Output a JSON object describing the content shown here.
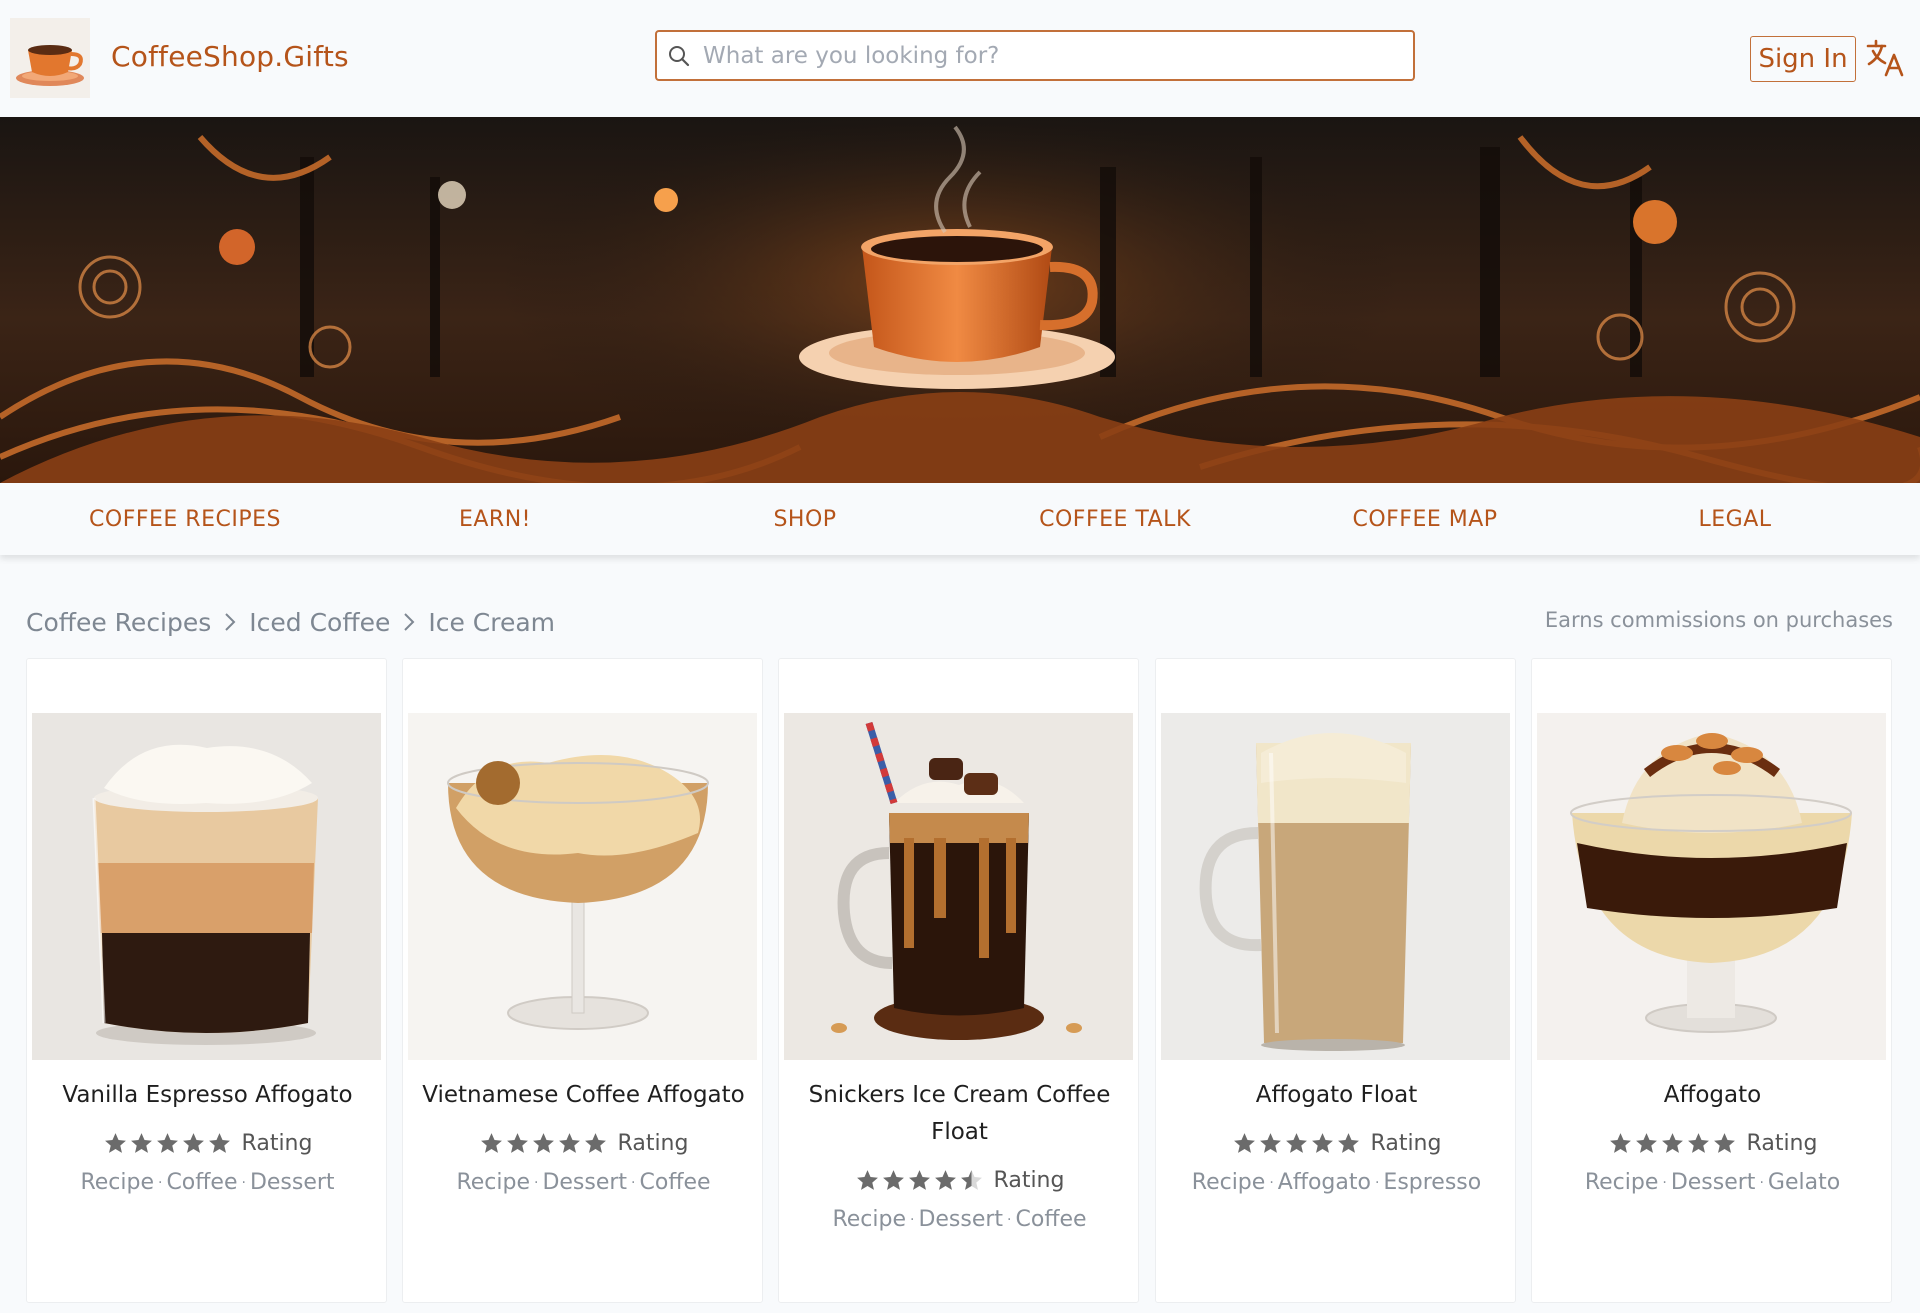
{
  "brand": {
    "name": "CoffeeShop.Gifts",
    "logo_icon": "coffee-cup-logo-icon"
  },
  "search": {
    "placeholder": "What are you looking for?",
    "value": "",
    "icon": "search-icon"
  },
  "auth": {
    "signin_label": "Sign In",
    "translate_icon": "translate-icon"
  },
  "nav": {
    "items": [
      {
        "label": "COFFEE RECIPES"
      },
      {
        "label": "EARN!"
      },
      {
        "label": "SHOP"
      },
      {
        "label": "COFFEE TALK"
      },
      {
        "label": "COFFEE MAP"
      },
      {
        "label": "LEGAL"
      }
    ]
  },
  "breadcrumb": {
    "items": [
      "Coffee Recipes",
      "Iced Coffee",
      "Ice Cream"
    ]
  },
  "commission_note": "Earns commissions on purchases",
  "recipes": [
    {
      "title": "Vanilla Espresso Affogato",
      "stars": 5,
      "rating_label": "Rating",
      "tags": [
        "Recipe",
        "Coffee",
        "Dessert"
      ]
    },
    {
      "title": "Vietnamese Coffee Affogato",
      "stars": 5,
      "rating_label": "Rating",
      "tags": [
        "Recipe",
        "Dessert",
        "Coffee"
      ]
    },
    {
      "title": "Snickers Ice Cream Coffee Float",
      "stars": 4.5,
      "rating_label": "Rating",
      "tags": [
        "Recipe",
        "Dessert",
        "Coffee"
      ]
    },
    {
      "title": "Affogato Float",
      "stars": 5,
      "rating_label": "Rating",
      "tags": [
        "Recipe",
        "Affogato",
        "Espresso"
      ]
    },
    {
      "title": "Affogato",
      "stars": 5,
      "rating_label": "Rating",
      "tags": [
        "Recipe",
        "Dessert",
        "Gelato"
      ]
    }
  ],
  "colors": {
    "accent": "#b5541a",
    "border_accent": "#c2703a",
    "muted_text": "#8a919a",
    "star": "#6b6b6b"
  }
}
